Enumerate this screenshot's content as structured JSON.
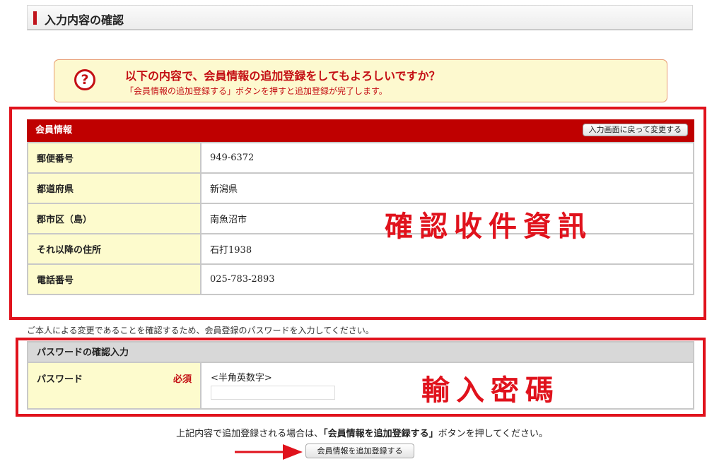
{
  "page": {
    "title": "入力内容の確認"
  },
  "notice": {
    "icon": "question-circle-icon",
    "question": "以下の内容で、会員情報の追加登録をしてもよろしいですか？",
    "sub": "「会員情報の追加登録する」ボタンを押すと追加登録が完了します。"
  },
  "member": {
    "section_title": "会員情報",
    "back_button": "入力画面に戻って変更する",
    "rows": [
      {
        "label": "郵便番号",
        "value": "949-6372"
      },
      {
        "label": "都道府県",
        "value": "新潟県"
      },
      {
        "label": "郡市区（島）",
        "value": "南魚沼市"
      },
      {
        "label": "それ以降の住所",
        "value": "石打1938"
      },
      {
        "label": "電話番号",
        "value": "025-783-2893"
      }
    ]
  },
  "password": {
    "note": "ご本人による変更であることを確認するため、会員登録のパスワードを入力してください。",
    "section_title": "パスワードの確認入力",
    "label": "パスワード",
    "required": "必須",
    "hint": "<半角英数字>",
    "value": ""
  },
  "footer": {
    "note_prefix": "上記内容で追加登録される場合は、",
    "note_bold": "「会員情報を追加登録する」",
    "note_suffix": "ボタンを押してください。",
    "submit_button": "会員情報を追加登録する"
  },
  "annotations": {
    "member_caption": "確認收件資訊",
    "password_caption": "輸入密碼",
    "color": "#e0121c"
  }
}
